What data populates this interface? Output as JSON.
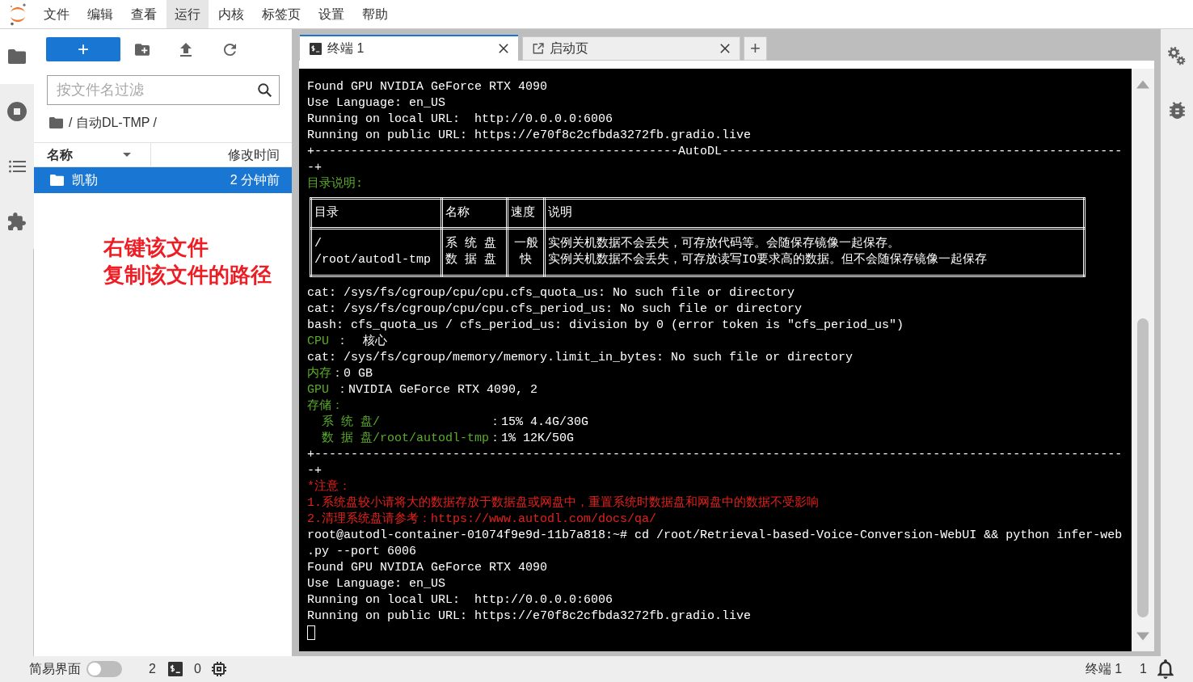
{
  "menu": [
    {
      "label": "文件",
      "selected": false
    },
    {
      "label": "编辑",
      "selected": false
    },
    {
      "label": "查看",
      "selected": false
    },
    {
      "label": "运行",
      "selected": true
    },
    {
      "label": "内核",
      "selected": false
    },
    {
      "label": "标签页",
      "selected": false
    },
    {
      "label": "设置",
      "selected": false
    },
    {
      "label": "帮助",
      "selected": false
    }
  ],
  "activity_bar": [
    {
      "kind": "files",
      "selected": true
    },
    {
      "kind": "running",
      "selected": false
    },
    {
      "kind": "toc",
      "selected": false
    },
    {
      "kind": "extensions",
      "selected": false
    }
  ],
  "file_browser": {
    "new_button": "+",
    "filter": {
      "placeholder": "按文件名过滤"
    },
    "breadcrumb": "/ 自动DL-TMP /",
    "columns": [
      "名称",
      "修改时间"
    ],
    "rows": [
      {
        "name": "凯勒",
        "modified": "2 分钟前",
        "selected": true
      }
    ]
  },
  "annotation": [
    "右键该文件",
    "复制该文件的路径"
  ],
  "tabs": [
    {
      "kind": "terminal",
      "label": "终端 1",
      "selected": true
    },
    {
      "kind": "launcher",
      "label": "启动页",
      "selected": false
    }
  ],
  "add_tab": "+",
  "terminal": {
    "blocks": [
      {
        "kind": "line",
        "segments": [
          {
            "text": "Found GPU NVIDIA GeForce RTX 4090",
            "color": "#ffffff"
          }
        ]
      },
      {
        "kind": "line",
        "segments": [
          {
            "text": "Use Language: en_US",
            "color": "#ffffff"
          }
        ]
      },
      {
        "kind": "line",
        "segments": [
          {
            "text": "Running on local URL:  http://0.0.0.0:6006",
            "color": "#ffffff"
          }
        ]
      },
      {
        "kind": "line",
        "segments": [
          {
            "text": "Running on public URL: https://e70f8c2cfbda3272fb.gradio.live",
            "color": "#ffffff"
          }
        ]
      },
      {
        "kind": "line",
        "segments": [
          {
            "text": "+--------------------------------------------------AutoDL-------------------------------------------------------",
            "color": "#ffffff"
          }
        ]
      },
      {
        "kind": "line",
        "segments": [
          {
            "text": "-+",
            "color": "#ffffff"
          }
        ]
      },
      {
        "kind": "line",
        "segments": [
          {
            "text": "目录说明:",
            "color": "#5aac2a"
          }
        ]
      },
      {
        "kind": "table",
        "columns": [
          "目录",
          "名称",
          "速度",
          "说明"
        ],
        "rows": [
          [
            [
              "/",
              "/root/autodl-tmp"
            ],
            [
              "系 统 盘",
              "数 据 盘"
            ],
            [
              "一般",
              "快"
            ],
            [
              "实例关机数据不会丢失，可存放代码等。会随保存镜像一起保存。",
              "实例关机数据不会丢失，可存放读写IO要求高的数据。但不会随保存镜像一起保存"
            ]
          ]
        ]
      },
      {
        "kind": "line",
        "segments": [
          {
            "text": "cat: /sys/fs/cgroup/cpu/cpu.cfs_quota_us: No such file or directory",
            "color": "#ffffff"
          }
        ]
      },
      {
        "kind": "line",
        "segments": [
          {
            "text": "cat: /sys/fs/cgroup/cpu/cpu.cfs_period_us: No such file or directory",
            "color": "#ffffff"
          }
        ]
      },
      {
        "kind": "line",
        "segments": [
          {
            "text": "bash: cfs_quota_us / cfs_period_us: division by 0 (error token is \"cfs_period_us\")",
            "color": "#ffffff"
          }
        ]
      },
      {
        "kind": "line",
        "segments": [
          {
            "text": "CPU",
            "color": "#5aac2a"
          },
          {
            "text": " ：  核心",
            "color": "#ffffff"
          }
        ]
      },
      {
        "kind": "line",
        "segments": [
          {
            "text": "cat: /sys/fs/cgroup/memory/memory.limit_in_bytes: No such file or directory",
            "color": "#ffffff"
          }
        ]
      },
      {
        "kind": "line",
        "segments": [
          {
            "text": "内存",
            "color": "#5aac2a"
          },
          {
            "text": "：0 GB",
            "color": "#ffffff"
          }
        ]
      },
      {
        "kind": "line",
        "segments": [
          {
            "text": "GPU",
            "color": "#5aac2a"
          },
          {
            "text": " ：NVIDIA GeForce RTX 4090, 2",
            "color": "#ffffff"
          }
        ]
      },
      {
        "kind": "line",
        "segments": [
          {
            "text": "存储：",
            "color": "#5aac2a"
          }
        ]
      },
      {
        "kind": "line",
        "segments": [
          {
            "text": "  系 统 盘/",
            "color": "#5aac2a"
          },
          {
            "text": "               ：15% 4.4G/30G",
            "color": "#ffffff"
          }
        ]
      },
      {
        "kind": "line",
        "segments": [
          {
            "text": "  数 据 盘/root/autodl-tmp",
            "color": "#5aac2a"
          },
          {
            "text": "：1% 12K/50G",
            "color": "#ffffff"
          }
        ]
      },
      {
        "kind": "line",
        "segments": [
          {
            "text": "+---------------------------------------------------------------------------------------------------------------",
            "color": "#ffffff"
          }
        ]
      },
      {
        "kind": "line",
        "segments": [
          {
            "text": "-+",
            "color": "#ffffff"
          }
        ]
      },
      {
        "kind": "line",
        "segments": [
          {
            "text": "*注意：",
            "color": "#e3201b"
          }
        ]
      },
      {
        "kind": "line",
        "segments": [
          {
            "text": "1.系统盘较小请将大的数据存放于数据盘或网盘中，重置系统时数据盘和网盘中的数据不受影响",
            "color": "#e3201b"
          }
        ]
      },
      {
        "kind": "line",
        "segments": [
          {
            "text": "2.清理系统盘请参考：https://www.autodl.com/docs/qa/",
            "color": "#e3201b"
          }
        ]
      },
      {
        "kind": "line",
        "segments": [
          {
            "text": "root@autodl-container-01074f9e9d-11b7a818:~# cd /root/Retrieval-based-Voice-Conversion-WebUI && python infer-web",
            "color": "#ffffff"
          }
        ]
      },
      {
        "kind": "line",
        "segments": [
          {
            "text": ".py --port 6006",
            "color": "#ffffff"
          }
        ]
      },
      {
        "kind": "line",
        "segments": [
          {
            "text": "Found GPU NVIDIA GeForce RTX 4090",
            "color": "#ffffff"
          }
        ]
      },
      {
        "kind": "line",
        "segments": [
          {
            "text": "Use Language: en_US",
            "color": "#ffffff"
          }
        ]
      },
      {
        "kind": "line",
        "segments": [
          {
            "text": "Running on local URL:  http://0.0.0.0:6006",
            "color": "#ffffff"
          }
        ]
      },
      {
        "kind": "line",
        "segments": [
          {
            "text": "Running on public URL: https://e70f8c2cfbda3272fb.gradio.live",
            "color": "#ffffff"
          }
        ]
      },
      {
        "kind": "cursor"
      }
    ]
  },
  "status_bar": {
    "simple_mode": {
      "label": "简易界面",
      "on": false
    },
    "terminals": "2",
    "kernels": "0",
    "active": "终端 1",
    "notifications": "1"
  }
}
